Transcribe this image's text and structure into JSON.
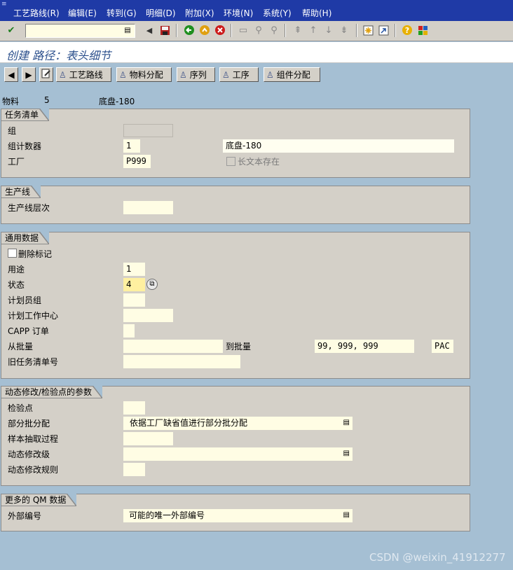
{
  "menubar": {
    "items": [
      "工艺路线(R)",
      "编辑(E)",
      "转到(G)",
      "明细(D)",
      "附加(X)",
      "环境(N)",
      "系统(Y)",
      "帮助(H)"
    ]
  },
  "toolbar": {
    "command_value": "",
    "icons": [
      "check-icon",
      "save-icon",
      "back-icon",
      "exit-icon",
      "cancel-icon",
      "print-icon",
      "find-icon",
      "find-next-icon",
      "first-page-icon",
      "prev-page-icon",
      "next-page-icon",
      "last-page-icon",
      "new-session-icon",
      "shortcut-icon",
      "help-icon",
      "layout-icon"
    ]
  },
  "title": "创建 路径：表头细节",
  "app_toolbar": {
    "prev": "◀",
    "next": "▶",
    "buttons": [
      "工艺路线",
      "物料分配",
      "序列",
      "工序",
      "组件分配"
    ]
  },
  "header": {
    "material_label": "物料",
    "material_value": "5",
    "material_desc": "底盘-180"
  },
  "task_list": {
    "title": "任务清单",
    "group_label": "组",
    "group_value": "",
    "counter_label": "组计数器",
    "counter_value": "1",
    "counter_desc": "底盘-180",
    "plant_label": "工厂",
    "plant_value": "P999",
    "longtext_label": "长文本存在"
  },
  "production_line": {
    "title": "生产线",
    "hierarchy_label": "生产线层次",
    "hierarchy_value": ""
  },
  "general": {
    "title": "通用数据",
    "delete_label": "删除标记",
    "usage_label": "用途",
    "usage_value": "1",
    "status_label": "状态",
    "status_value": "4",
    "planner_group_label": "计划员组",
    "planner_group_value": "",
    "work_center_label": "计划工作中心",
    "work_center_value": "",
    "capp_label": "CAPP 订单",
    "capp_value": "",
    "from_lot_label": "从批量",
    "from_lot_value": "",
    "to_lot_label": "到批量",
    "to_lot_value": "99, 999, 999",
    "unit_value": "PAC",
    "old_task_label": "旧任务清单号",
    "old_task_value": ""
  },
  "dynamic": {
    "title": "动态修改/检验点的参数",
    "inspection_point_label": "检验点",
    "inspection_point_value": "",
    "partial_lot_label": "部分批分配",
    "partial_lot_value": "依据工厂缺省值进行部分批分配",
    "sampling_label": "样本抽取过程",
    "sampling_value": "",
    "dyn_level_label": "动态修改级",
    "dyn_level_value": "",
    "dyn_rule_label": "动态修改规则",
    "dyn_rule_value": ""
  },
  "qm": {
    "title": "更多的 QM 数据",
    "ext_number_label": "外部编号",
    "ext_number_value": "可能的唯一外部编号"
  },
  "watermark": "CSDN @weixin_41912277"
}
